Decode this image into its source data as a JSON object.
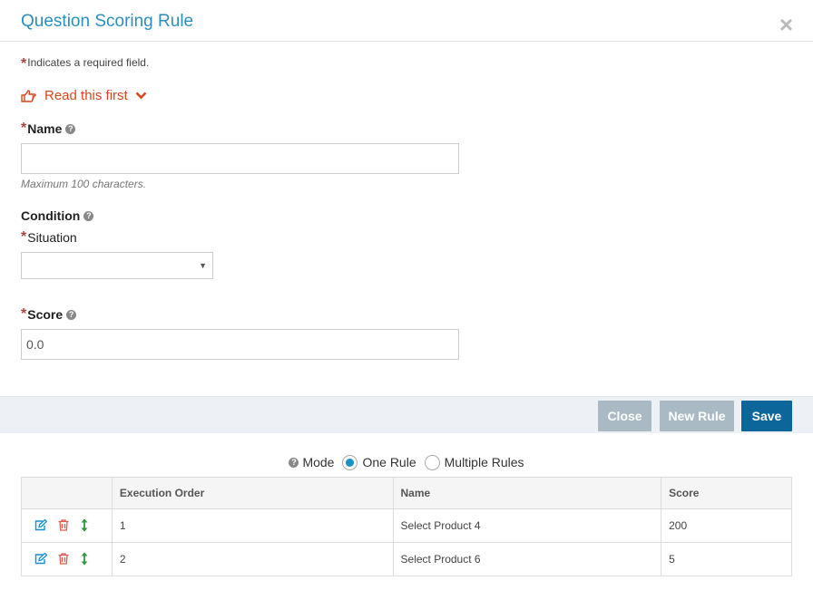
{
  "dialog": {
    "title": "Question Scoring Rule",
    "close_symbol": "×"
  },
  "form": {
    "required_star": "*",
    "required_note": "Indicates a required field.",
    "read_first": "Read this first",
    "name_label": "Name",
    "name_value": "",
    "name_hint": "Maximum 100 characters.",
    "condition_label": "Condition",
    "situation_label": "Situation",
    "situation_value": "",
    "score_label": "Score",
    "score_value": "0.0",
    "help_glyph": "?"
  },
  "toolbar": {
    "close_label": "Close",
    "new_rule_label": "New Rule",
    "save_label": "Save"
  },
  "mode": {
    "label": "Mode",
    "options": [
      "One Rule",
      "Multiple Rules"
    ],
    "selected": "One Rule"
  },
  "table": {
    "columns": [
      "",
      "Execution Order",
      "Name",
      "Score"
    ],
    "rows": [
      {
        "order": "1",
        "name": "Select Product 4",
        "score": "200"
      },
      {
        "order": "2",
        "name": "Select Product 6",
        "score": "5"
      }
    ]
  },
  "colors": {
    "title": "#2a8fbd",
    "accent_orange": "#d9461e",
    "required": "#a94442",
    "save_button": "#0d6699",
    "disabled_button": "#a9bac4",
    "edit_icon": "#1a8fcf",
    "delete_icon": "#e05a4f",
    "move_icon": "#2e9a3e"
  },
  "icons": {
    "read_first": "hand-point-right-icon",
    "expand": "chevron-down-icon",
    "row_actions": [
      "edit-icon",
      "trash-icon",
      "move-vertical-icon"
    ]
  }
}
